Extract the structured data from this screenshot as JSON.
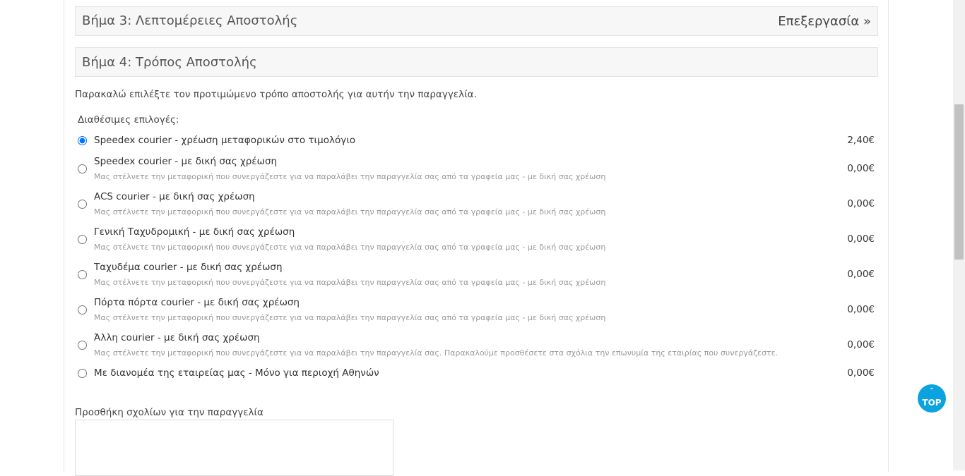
{
  "step3": {
    "title": "Βήμα 3: Λεπτομέρειες Αποστολής",
    "edit_label": "Επεξεργασία »"
  },
  "step4": {
    "title": "Βήμα 4: Τρόπος Αποστολής"
  },
  "intro": "Παρακαλώ επιλέξτε τον προτιμώμενο τρόπο αποστολής για αυτήν την παραγγελία.",
  "available_label": "Διαθέσιμες επιλογές:",
  "options": [
    {
      "title": "Speedex courier - χρέωση μεταφορικών στο τιμολόγιο",
      "desc": "",
      "price": "2,40€",
      "selected": true
    },
    {
      "title": "Speedex courier - με δική σας χρέωση",
      "desc": "Μας στέλνετε την μεταφορική που συνεργάζεστε για να παραλάβει την παραγγελία σας από τα γραφεία μας - με δική σας χρέωση",
      "price": "0,00€",
      "selected": false
    },
    {
      "title": "ACS courier - με δική σας χρέωση",
      "desc": "Μας στέλνετε την μεταφορική που συνεργάζεστε για να παραλάβει την παραγγελία σας από τα γραφεία μας - με δική σας χρέωση",
      "price": "0,00€",
      "selected": false
    },
    {
      "title": "Γενική Ταχυδρομική - με δική σας χρέωση",
      "desc": "Μας στέλνετε την μεταφορική που συνεργάζεστε για να παραλάβει την παραγγελία σας από τα γραφεία μας - με δική σας χρέωση",
      "price": "0,00€",
      "selected": false
    },
    {
      "title": "Ταχυδέμα courier - με δική σας χρέωση",
      "desc": "Μας στέλνετε την μεταφορική που συνεργάζεστε για να παραλάβει την παραγγελία σας από τα γραφεία μας - με δική σας χρέωση",
      "price": "0,00€",
      "selected": false
    },
    {
      "title": "Πόρτα πόρτα courier - με δική σας χρέωση",
      "desc": "Μας στέλνετε την μεταφορική που συνεργάζεστε για να παραλάβει την παραγγελία σας από τα γραφεία μας - με δική σας χρέωση",
      "price": "0,00€",
      "selected": false
    },
    {
      "title": "Άλλη courier - με δική σας χρέωση",
      "desc": "Μας στέλνετε την μεταφορική που συνεργάζεστε για να παραλάβει την παραγγελία σας. Παρακαλούμε προσθέσετε στα σχόλια την επωνυμία της εταιρίας που συνεργάζεστε.",
      "price": "0,00€",
      "selected": false
    },
    {
      "title": "Με διανομέα της εταιρείας μας - Μόνο για περιοχή Αθηνών",
      "desc": "",
      "price": "0,00€",
      "selected": false
    }
  ],
  "comments": {
    "label": "Προσθήκη σχολίων για την παραγγελία",
    "value": ""
  },
  "top_button": {
    "label": "TOP",
    "icon": "chevron-up-icon"
  },
  "colors": {
    "accent": "#0aa3e0",
    "panel_bg": "#f7f7f7"
  }
}
